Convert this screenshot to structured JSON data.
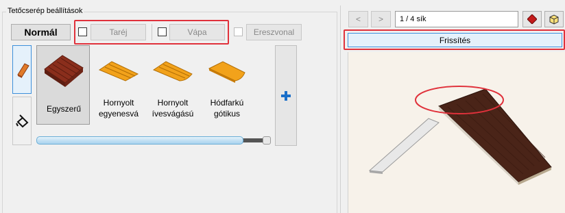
{
  "settings_panel": {
    "title": "Tetőcserép beállítások",
    "mode_button": "Normál",
    "options": [
      {
        "label": "Taréj",
        "checked": false
      },
      {
        "label": "Vápa",
        "checked": false
      },
      {
        "label": "Ereszvonal",
        "checked": false
      }
    ],
    "tiles": [
      {
        "label": "Egyszerű",
        "selected": true,
        "icon": "tile-flat-brown-icon"
      },
      {
        "label": "Hornyolt egyenesvá",
        "selected": false,
        "icon": "tile-grooved-straight-icon"
      },
      {
        "label": "Hornyolt ívesvágású",
        "selected": false,
        "icon": "tile-grooved-curved-icon"
      },
      {
        "label": "Hódfarkú gótikus",
        "selected": false,
        "icon": "tile-beavertail-icon"
      }
    ],
    "add_button_icon": "plus-icon"
  },
  "preview_panel": {
    "prev_label": "<",
    "next_label": ">",
    "page_indicator": "1 / 4 sík",
    "refresh_label": "Frissítés"
  },
  "colors": {
    "highlight_red": "#e0313b",
    "roof_brown": "#4a2418",
    "tile_orange": "#f2a21b",
    "preview_bg": "#f7f2ea",
    "selected_blue": "#3c8fdb"
  }
}
